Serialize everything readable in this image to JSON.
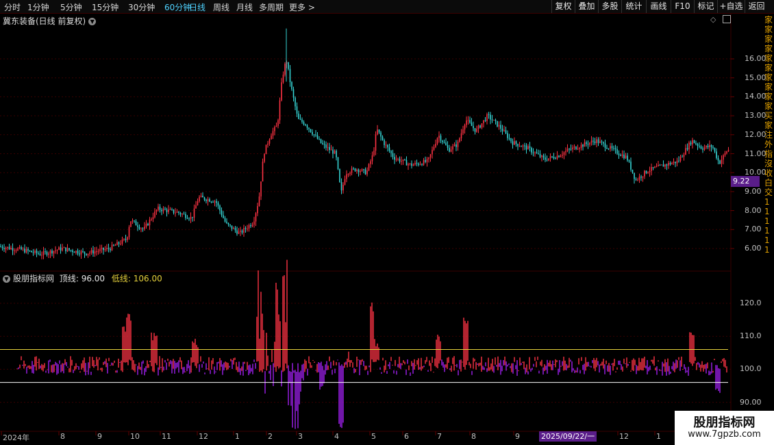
{
  "toolbar": {
    "periods": [
      {
        "label": "分时",
        "active": false
      },
      {
        "label": "1分钟",
        "active": false
      },
      {
        "label": "5分钟",
        "active": false
      },
      {
        "label": "15分钟",
        "active": false
      },
      {
        "label": "30分钟",
        "active": false
      },
      {
        "label": "60分钟",
        "active": false
      },
      {
        "label": "日线",
        "active": true
      },
      {
        "label": "周线",
        "active": false
      },
      {
        "label": "月线",
        "active": false
      },
      {
        "label": "多周期",
        "active": false
      },
      {
        "label": "更多 >",
        "active": false
      }
    ],
    "right_buttons": [
      "复权",
      "叠加",
      "多股",
      "统计",
      "画线",
      "F10",
      "标记",
      "+自选",
      "返回"
    ]
  },
  "main_chart": {
    "title": "冀东装备(日线 前复权)",
    "current_price_tag": "9.22",
    "price_ticks": [
      "16.00",
      "15.00",
      "14.00",
      "13.00",
      "12.00",
      "11.00",
      "10.00",
      "9.00",
      "8.00",
      "7.00",
      "6.00"
    ]
  },
  "indicator": {
    "name": "股朋指标网",
    "top_line_label": "顶线: 96.00",
    "low_line_label": "低线: 106.00",
    "ticks": [
      "120.0",
      "110.0",
      "100.0",
      "90.00"
    ],
    "colors": {
      "top_line": "#ffffff",
      "low_line": "#e6d23c",
      "label_yellow": "#e6d23c"
    }
  },
  "x_axis": {
    "labels": [
      "2024年",
      "8",
      "9",
      "10",
      "11",
      "12",
      "1",
      "2",
      "3",
      "4",
      "5",
      "6",
      "7",
      "8",
      "9",
      "2025/09/22/一",
      "12",
      "1"
    ]
  },
  "right_column_chars": [
    "家",
    "家",
    "家",
    "家",
    "家",
    "家",
    "家",
    "家",
    "家",
    "家",
    "买",
    "家",
    "注",
    "外",
    "指",
    "沒",
    "收",
    "白",
    "交",
    "1",
    "1",
    "1",
    "1",
    "1",
    "1"
  ],
  "watermark": {
    "title": "股朋指标网",
    "url": "www.7gpzb.com"
  },
  "colors": {
    "up": "#ff3344",
    "down": "#36d6d6",
    "ind_up": "#ff3344",
    "ind_down": "#a020f0",
    "grid": "#3a0000",
    "tag_bg": "#5a1d8a"
  }
}
